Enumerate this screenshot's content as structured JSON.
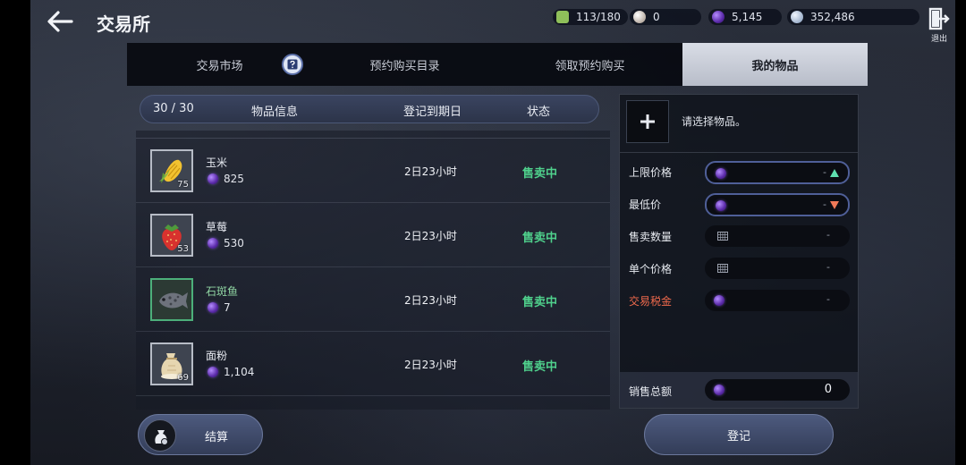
{
  "header": {
    "title": "交易所",
    "currencies": [
      {
        "icon": "backpack-icon",
        "value": "113/180",
        "color": "#8fbf5a"
      },
      {
        "icon": "pearl-icon",
        "value": "0",
        "color": "#cfc6be"
      },
      {
        "icon": "purple-gem-icon",
        "value": "5,145",
        "color": "#7d4bd6"
      },
      {
        "icon": "silver-coin-icon",
        "value": "352,486",
        "color": "#b9c8dc"
      }
    ],
    "exit_label": "退出"
  },
  "tabs": [
    {
      "label": "交易市场",
      "active": false
    },
    {
      "label": "预约购买目录",
      "active": false
    },
    {
      "label": "领取预约购买",
      "active": false
    },
    {
      "label": "我的物品",
      "active": true
    }
  ],
  "list": {
    "count": "30 / 30",
    "col_info": "物品信息",
    "col_date": "登记到期日",
    "col_status": "状态",
    "items": [
      {
        "name": "玉米",
        "qty": "75",
        "price": "825",
        "date": "2日23小时",
        "status": "售卖中",
        "rare": false
      },
      {
        "name": "草莓",
        "qty": "53",
        "price": "530",
        "date": "2日23小时",
        "status": "售卖中",
        "rare": false
      },
      {
        "name": "石斑鱼",
        "qty": "",
        "price": "7",
        "date": "2日23小时",
        "status": "售卖中",
        "rare": true
      },
      {
        "name": "面粉",
        "qty": "69",
        "price": "1,104",
        "date": "2日23小时",
        "status": "售卖中",
        "rare": false
      }
    ]
  },
  "settle_label": "结算",
  "form": {
    "select_hint": "请选择物品。",
    "max_price_label": "上限价格",
    "min_price_label": "最低价",
    "sell_qty_label": "售卖数量",
    "unit_price_label": "单个价格",
    "tax_label": "交易税金",
    "dash": "-",
    "total_label": "销售总额",
    "total_value": "0",
    "register_label": "登记"
  },
  "colors": {
    "status_green": "#4fd08c",
    "tax_red": "#f06a4c",
    "active_tab": "#c9cdd7"
  }
}
